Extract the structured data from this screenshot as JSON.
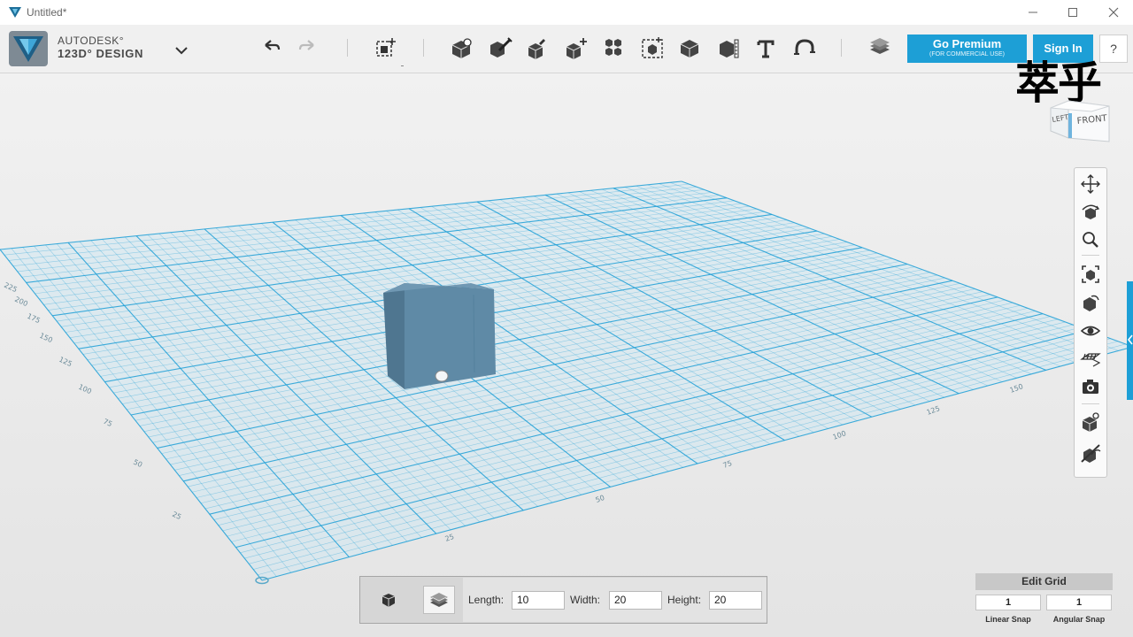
{
  "window": {
    "title": "Untitled*",
    "controls": {
      "minimize": "minimize-icon",
      "maximize": "maximize-icon",
      "close": "close-icon"
    }
  },
  "brand": {
    "line1": "AUTODESK°",
    "line2": "123D° DESIGN",
    "menu_icon": "chevron-down-icon"
  },
  "toolbar": {
    "history": [
      {
        "icon": "undo-icon"
      },
      {
        "icon": "redo-icon"
      }
    ],
    "tools": [
      {
        "icon": "transform-icon"
      },
      {
        "icon": "primitives-icon"
      },
      {
        "icon": "sketch-icon"
      },
      {
        "icon": "construct-icon"
      },
      {
        "icon": "modify-icon"
      },
      {
        "icon": "pattern-icon"
      },
      {
        "icon": "grouping-icon"
      },
      {
        "icon": "combine-icon"
      },
      {
        "icon": "measure-icon"
      },
      {
        "icon": "text-icon"
      },
      {
        "icon": "snap-icon"
      },
      {
        "icon": "material-icon"
      }
    ],
    "premium": {
      "label": "Go Premium",
      "sublabel": "(FOR COMMERCIAL USE)"
    },
    "signin": {
      "label": "Sign In"
    },
    "help": {
      "label": "?"
    }
  },
  "watermark": "萃乎",
  "viewcube": {
    "left_label": "LEFT",
    "front_label": "FRONT"
  },
  "grid_axis_labels": {
    "left_edge": [
      "25",
      "50",
      "75",
      "100",
      "125",
      "150",
      "175",
      "200",
      "225"
    ],
    "front_edge": [
      "25",
      "50",
      "75",
      "100",
      "125",
      "150"
    ]
  },
  "nav_bar": [
    {
      "icon": "pan-icon"
    },
    {
      "icon": "orbit-icon"
    },
    {
      "icon": "zoom-icon"
    },
    {
      "icon": "fit-icon"
    },
    {
      "icon": "views-icon"
    },
    {
      "icon": "visibility-icon"
    },
    {
      "icon": "grid-display-icon"
    },
    {
      "icon": "screenshot-icon"
    },
    {
      "icon": "material-display-icon"
    },
    {
      "icon": "hide-icon"
    }
  ],
  "accent_color": "#1d9fd6",
  "dimensions": {
    "length_label": "Length:",
    "length_value": "10",
    "width_label": "Width:",
    "width_value": "20",
    "height_label": "Height:",
    "height_value": "20"
  },
  "grid_panel": {
    "edit_label": "Edit Grid",
    "linear_snap_value": "1",
    "linear_snap_label": "Linear Snap",
    "angular_snap_value": "1",
    "angular_snap_label": "Angular Snap"
  }
}
